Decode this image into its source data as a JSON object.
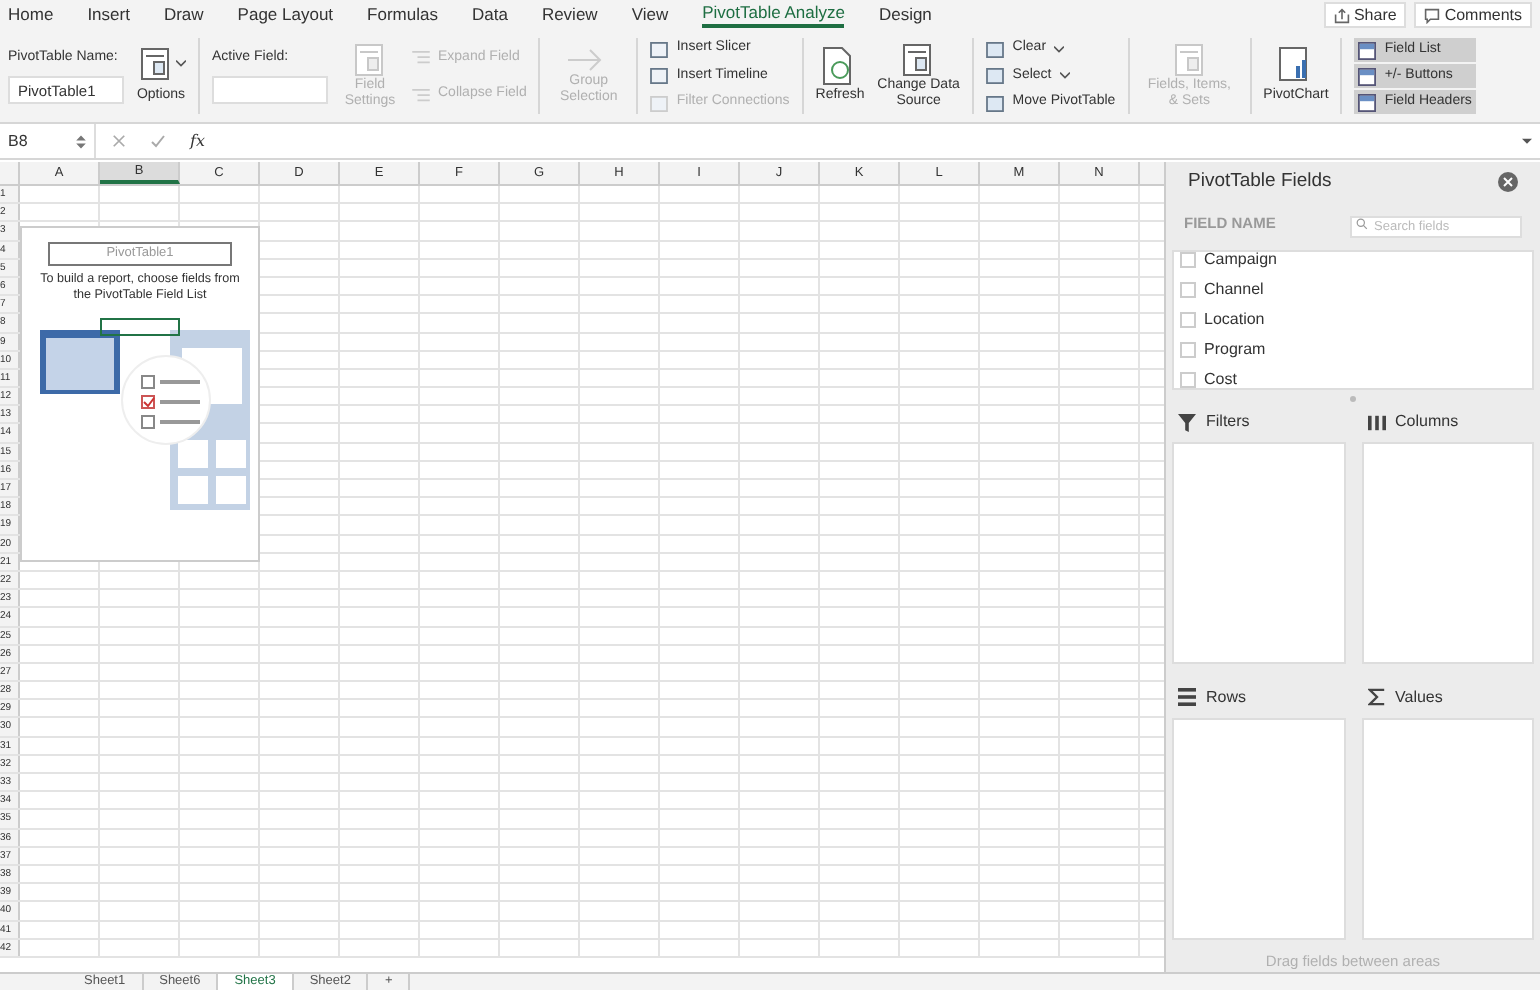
{
  "menu_tabs": [
    {
      "label": "Home",
      "selected": false
    },
    {
      "label": "Insert",
      "selected": false
    },
    {
      "label": "Draw",
      "selected": false
    },
    {
      "label": "Page Layout",
      "selected": false
    },
    {
      "label": "Formulas",
      "selected": false
    },
    {
      "label": "Data",
      "selected": false
    },
    {
      "label": "Review",
      "selected": false
    },
    {
      "label": "View",
      "selected": false
    },
    {
      "label": "PivotTable Analyze",
      "selected": true
    },
    {
      "label": "Design",
      "selected": false
    }
  ],
  "share_button": "Share",
  "comments_button": "Comments",
  "ribbon": {
    "pivottable_name": {
      "label": "PivotTable Name:",
      "value": "PivotTable1"
    },
    "options": {
      "label": "Options",
      "disabled": false
    },
    "active_field": {
      "label": "Active Field:"
    },
    "field_settings": {
      "label": "Field Settings",
      "disabled": true
    },
    "expand_field": {
      "label": "Expand Field",
      "disabled": true
    },
    "collapse_field": {
      "label": "Collapse Field",
      "disabled": true
    },
    "group_selection": {
      "label": "Group Selection",
      "disabled": true
    },
    "insert_items": [
      {
        "label": "Insert Slicer",
        "disabled": false
      },
      {
        "label": "Insert Timeline",
        "disabled": false
      },
      {
        "label": "Filter Connections",
        "disabled": true
      }
    ],
    "refresh": {
      "label": "Refresh",
      "disabled": false
    },
    "change_data_source": {
      "label": "Change Data Source",
      "disabled": false
    },
    "action_items": [
      {
        "label": "Clear",
        "dropdown": true
      },
      {
        "label": "Select",
        "dropdown": true
      },
      {
        "label": "Move PivotTable",
        "dropdown": false
      }
    ],
    "fields_items_sets": {
      "label": "Fields, Items, & Sets",
      "disabled": true
    },
    "pivotchart": {
      "label": "PivotChart",
      "disabled": false
    },
    "show_toggles": [
      {
        "label": "Field List",
        "on": true
      },
      {
        "label": "+/- Buttons",
        "on": true
      },
      {
        "label": "Field Headers",
        "on": true
      }
    ]
  },
  "formula_bar": {
    "name_box": "B8",
    "fx": "fx"
  },
  "grid": {
    "columns": [
      {
        "label": "A",
        "selected": false
      },
      {
        "label": "B",
        "selected": true
      },
      {
        "label": "C",
        "selected": false
      },
      {
        "label": "D",
        "selected": false
      },
      {
        "label": "E",
        "selected": false
      },
      {
        "label": "F",
        "selected": false
      },
      {
        "label": "G",
        "selected": false
      },
      {
        "label": "H",
        "selected": false
      },
      {
        "label": "I",
        "selected": false
      },
      {
        "label": "J",
        "selected": false
      },
      {
        "label": "K",
        "selected": false
      },
      {
        "label": "L",
        "selected": false
      },
      {
        "label": "M",
        "selected": false
      },
      {
        "label": "N",
        "selected": false
      }
    ],
    "rows": [
      "1",
      "2",
      "3",
      "4",
      "5",
      "6",
      "7",
      "8",
      "9",
      "10",
      "11",
      "12",
      "13",
      "14",
      "15",
      "16",
      "17",
      "18",
      "19",
      "20",
      "21",
      "22",
      "23",
      "24",
      "25",
      "26",
      "27",
      "28",
      "29",
      "30",
      "31",
      "32",
      "33",
      "34",
      "35",
      "36",
      "37",
      "38",
      "39",
      "40",
      "41",
      "42"
    ]
  },
  "pivot_placeholder": {
    "title": "PivotTable1",
    "instructions": "To build a report, choose fields from the PivotTable Field List"
  },
  "fields_pane": {
    "title": "PivotTable Fields",
    "field_name_label": "FIELD NAME",
    "search": {
      "placeholder": "Search fields"
    },
    "fields": [
      {
        "label": "Campaign",
        "checked": false
      },
      {
        "label": "Channel",
        "checked": false
      },
      {
        "label": "Location",
        "checked": false
      },
      {
        "label": "Program",
        "checked": false
      },
      {
        "label": "Cost",
        "checked": false
      }
    ],
    "areas": [
      {
        "kind": "filters",
        "label": "Filters"
      },
      {
        "kind": "columns",
        "label": "Columns"
      },
      {
        "kind": "rows",
        "label": "Rows"
      },
      {
        "kind": "values",
        "label": "Values"
      }
    ],
    "footer": "Drag fields between areas"
  },
  "sheet_tabs": [
    {
      "label": "Sheet1",
      "selected": false
    },
    {
      "label": "Sheet6",
      "selected": false
    },
    {
      "label": "Sheet3",
      "selected": true
    },
    {
      "label": "Sheet2",
      "selected": false
    },
    {
      "label": "+",
      "selected": false
    }
  ]
}
